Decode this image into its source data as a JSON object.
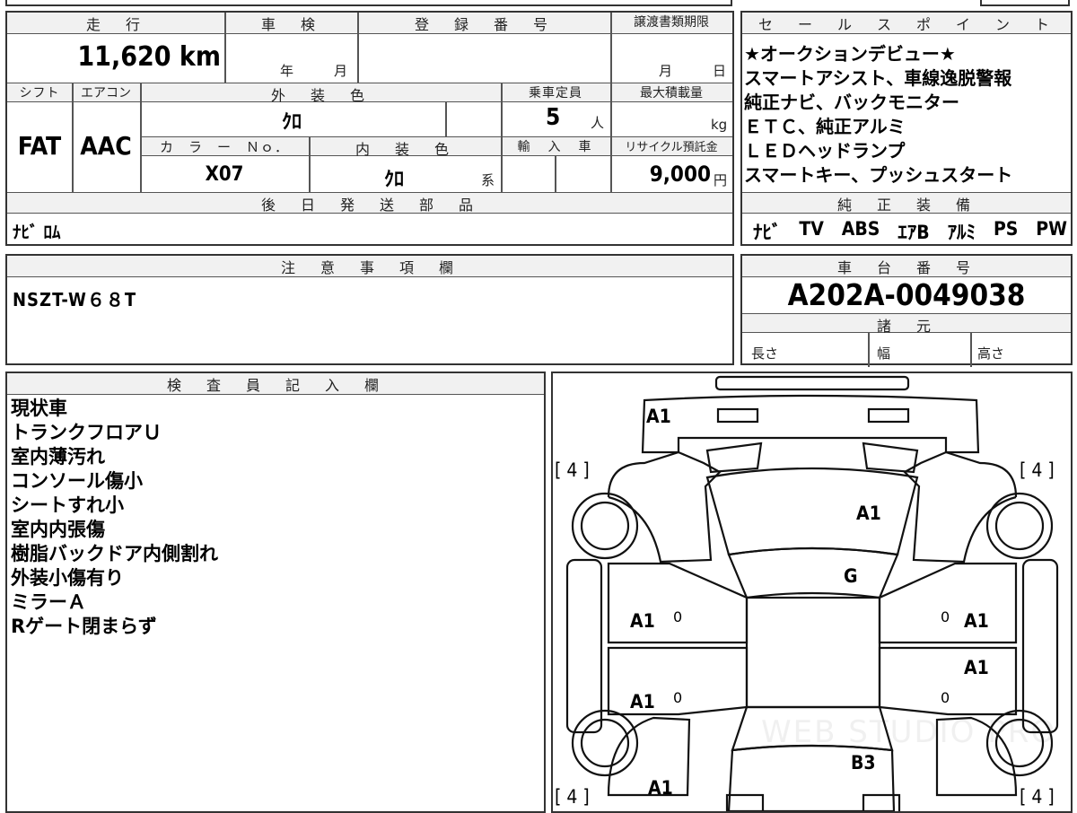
{
  "top": {
    "headers": {
      "mileage": "走　行",
      "inspection": "車　検",
      "registration": "登　録　番　号",
      "transfer_deadline": "譲渡書類期限",
      "shift": "シフト",
      "aircon": "エアコン",
      "exterior_color": "外　装　色",
      "capacity": "乗車定員",
      "max_load": "最大積載量",
      "color_no": "カ　ラ　ー　Ｎｏ．",
      "interior_color": "内　装　色",
      "import": "輸　入　車",
      "recycle_fee": "リサイクル預託金",
      "later_parts": "後　日　発　送　部　品"
    },
    "values": {
      "mileage": "11,620 km",
      "insp_year_unit": "年",
      "insp_month_unit": "月",
      "transfer_month_unit": "月",
      "transfer_day_unit": "日",
      "shift": "FAT",
      "aircon": "AAC",
      "exterior_color": "ｸﾛ",
      "capacity": "5",
      "capacity_unit": "人",
      "max_load_unit": "kg",
      "color_no": "X07",
      "interior_color": "ｸﾛ",
      "interior_suffix": "系",
      "recycle_fee": "9,000",
      "recycle_unit": "円",
      "later_parts": "ﾅﾋﾞ ﾛﾑ"
    }
  },
  "sales_points": {
    "header": "セ　ー　ル　ス　ポ　イ　ン　ト",
    "lines": [
      "★オークションデビュー★",
      "スマートアシスト、車線逸脱警報",
      "純正ナビ、バックモニター",
      "ＥＴＣ、純正アルミ",
      "ＬＥＤヘッドランプ",
      "スマートキー、プッシュスタート"
    ],
    "equipment_header": "純　正　装　備",
    "equipment": [
      "ﾅﾋﾞ",
      "TV",
      "ABS",
      "ｴｱB",
      "ｱﾙﾐ",
      "PS",
      "PW"
    ]
  },
  "notes": {
    "header": "注　意　事　項　欄",
    "text": "NSZT-W６８T"
  },
  "chassis": {
    "header": "車　台　番　号",
    "number": "A202A-0049038",
    "spec_header": "諸　元",
    "length_label": "長さ",
    "width_label": "幅",
    "height_label": "高さ"
  },
  "inspector": {
    "header": "検　査　員　記　入　欄",
    "lines": [
      "現状車",
      "トランクフロアＵ",
      "室内薄汚れ",
      "コンソール傷小",
      "シートすれ小",
      "室内内張傷",
      "樹脂バックドア内側割れ",
      "外装小傷有り",
      "ミラーＡ",
      "Rゲート閉まらず"
    ]
  },
  "diagram": {
    "tire_fl": "[ 4 ]",
    "tire_fr": "[ 4 ]",
    "tire_rl": "[ 4 ]",
    "tire_rr": "[ 4 ]",
    "front_bumper": "A1",
    "hood": "A1",
    "windshield": "G",
    "front_left_door": "A1",
    "front_right_door": "A1",
    "rear_right_door": "A1",
    "rear_left_door": "A1",
    "rear_hatch": "B3",
    "rear_left_quarter": "A1",
    "mark_0": "0",
    "watermark": "WEB STUDIO PRO"
  }
}
